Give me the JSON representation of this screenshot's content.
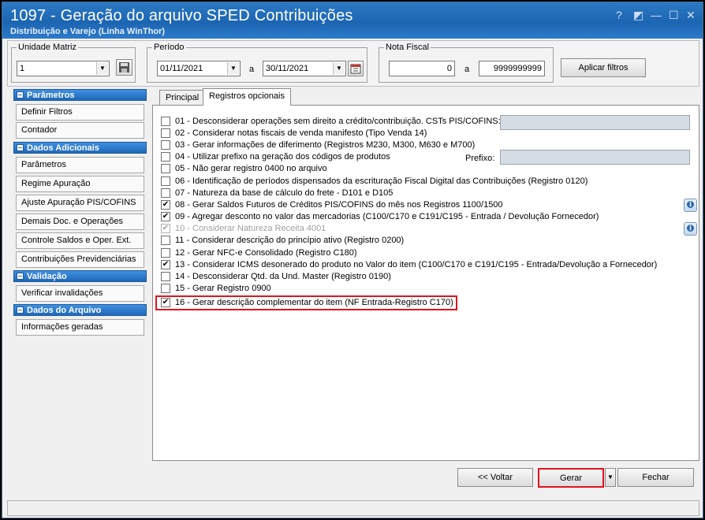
{
  "window": {
    "title": "1097 - Geração do arquivo SPED Contribuições",
    "subtitle": "Distribuição e Varejo (Linha WinThor)",
    "controls": [
      "?",
      "◩",
      "—",
      "☐",
      "✕"
    ]
  },
  "filters": {
    "unidade_label": "Unidade Matriz",
    "unidade_value": "1",
    "periodo_label": "Período",
    "periodo_from": "01/11/2021",
    "periodo_sep": "a",
    "periodo_to": "30/11/2021",
    "nota_label": "Nota Fiscal",
    "nota_from": "0",
    "nota_sep": "a",
    "nota_to": "9999999999",
    "apply_button": "Aplicar filtros"
  },
  "sidebar": {
    "sections": [
      {
        "title": "Parâmetros",
        "items": [
          "Definir Filtros",
          "Contador"
        ]
      },
      {
        "title": "Dados Adicionais",
        "items": [
          "Parâmetros",
          "Regime Apuração",
          "Ajuste Apuração PIS/COFINS",
          "Demais Doc. e Operações",
          "Controle Saldos e Oper. Ext.",
          "Contribuições Previdenciárias"
        ]
      },
      {
        "title": "Validação",
        "items": [
          "Verificar invalidações"
        ]
      },
      {
        "title": "Dados do Arquivo",
        "items": [
          "Informações geradas"
        ]
      }
    ]
  },
  "tabs": [
    "Principal",
    "Registros opcionais"
  ],
  "options": [
    {
      "label": "01 - Desconsiderar operações sem direito a crédito/contribuição. CSTs PIS/COFINS:",
      "checked": false,
      "disabled": false
    },
    {
      "label": "02 - Considerar notas fiscais de venda manifesto (Tipo Venda 14)",
      "checked": false,
      "disabled": false
    },
    {
      "label": "03 - Gerar informações de diferimento (Registros M230, M300, M630 e M700)",
      "checked": false,
      "disabled": false
    },
    {
      "label": "04 - Utilizar prefixo na geração dos códigos de produtos",
      "checked": false,
      "disabled": false
    },
    {
      "label": "05 - Não gerar registro 0400 no arquivo",
      "checked": false,
      "disabled": false
    },
    {
      "label": "06 - Identificação de períodos dispensados da escrituração Fiscal Digital das Contribuições (Registro 0120)",
      "checked": false,
      "disabled": false
    },
    {
      "label": "07 - Natureza da base de cálculo do frete - D101 e D105",
      "checked": false,
      "disabled": false
    },
    {
      "label": "08 - Gerar Saldos Futuros de Créditos PIS/COFINS do mês nos Registros 1100/1500",
      "checked": true,
      "disabled": false
    },
    {
      "label": "09 - Agregar desconto no valor das mercadorias (C100/C170 e C191/C195 - Entrada / Devolução Fornecedor)",
      "checked": true,
      "disabled": false
    },
    {
      "label": "10 - Considerar Natureza Receita 4001",
      "checked": true,
      "disabled": true
    },
    {
      "label": "11 - Considerar descrição do princípio ativo (Registro 0200)",
      "checked": false,
      "disabled": false
    },
    {
      "label": "12 - Gerar NFC-e Consolidado (Registro C180)",
      "checked": false,
      "disabled": false
    },
    {
      "label": "13 - Considerar ICMS desonerado do produto no Valor do item (C100/C170 e C191/C195 - Entrada/Devolução a Fornecedor)",
      "checked": true,
      "disabled": false
    },
    {
      "label": "14 - Desconsiderar Qtd. da Und. Master (Registro 0190)",
      "checked": false,
      "disabled": false
    },
    {
      "label": "15 - Gerar Registro 0900",
      "checked": false,
      "disabled": false
    },
    {
      "label": "16 - Gerar descrição complementar do item (NF Entrada-Registro C170)",
      "checked": true,
      "disabled": false
    }
  ],
  "prefixo_label": "Prefixo:",
  "check_mark": "✔",
  "footer": {
    "back_button": "<< Voltar",
    "generate_button": "Gerar",
    "close_button": "Fechar"
  },
  "colors": {
    "titlebar": "#1c65b1",
    "section_header": "#2168b8",
    "highlight": "#e0141e"
  }
}
